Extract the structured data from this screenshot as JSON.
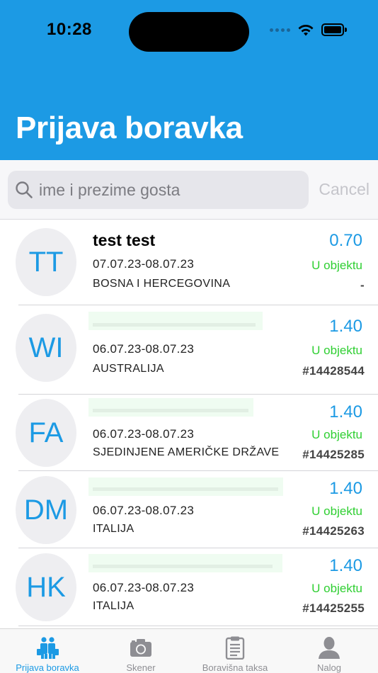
{
  "status_bar": {
    "time": "10:28"
  },
  "header": {
    "title": "Prijava boravka"
  },
  "search": {
    "placeholder": "ime i prezime gosta",
    "value": "",
    "cancel_label": "Cancel"
  },
  "guests": [
    {
      "initials": "TT",
      "name": "test test",
      "dates": "07.07.23-08.07.23",
      "country": "BOSNA I HERCEGOVINA",
      "amount": "0.70",
      "status": "U objektu",
      "ref": "-"
    },
    {
      "initials": "WI",
      "name": "",
      "dates": "06.07.23-08.07.23",
      "country": "AUSTRALIJA",
      "amount": "1.40",
      "status": "U objektu",
      "ref": "#14428544"
    },
    {
      "initials": "FA",
      "name": "",
      "dates": "06.07.23-08.07.23",
      "country": "SJEDINJENE AMERIČKE DRŽAVE",
      "amount": "1.40",
      "status": "U objektu",
      "ref": "#14425285"
    },
    {
      "initials": "DM",
      "name": "",
      "dates": "06.07.23-08.07.23",
      "country": "ITALIJA",
      "amount": "1.40",
      "status": "U objektu",
      "ref": "#14425263"
    },
    {
      "initials": "HK",
      "name": "",
      "dates": "06.07.23-08.07.23",
      "country": "ITALIJA",
      "amount": "1.40",
      "status": "U objektu",
      "ref": "#14425255"
    }
  ],
  "tab_bar": {
    "tabs": [
      {
        "label": "Prijava boravka",
        "icon": "people-icon",
        "active": true
      },
      {
        "label": "Skener",
        "icon": "camera-icon",
        "active": false
      },
      {
        "label": "Boravišna taksa",
        "icon": "clipboard-icon",
        "active": false
      },
      {
        "label": "Nalog",
        "icon": "person-icon",
        "active": false
      }
    ]
  },
  "colors": {
    "accent": "#1c9ae4",
    "status_green": "#2fcf32",
    "ref_gray": "#444444"
  }
}
